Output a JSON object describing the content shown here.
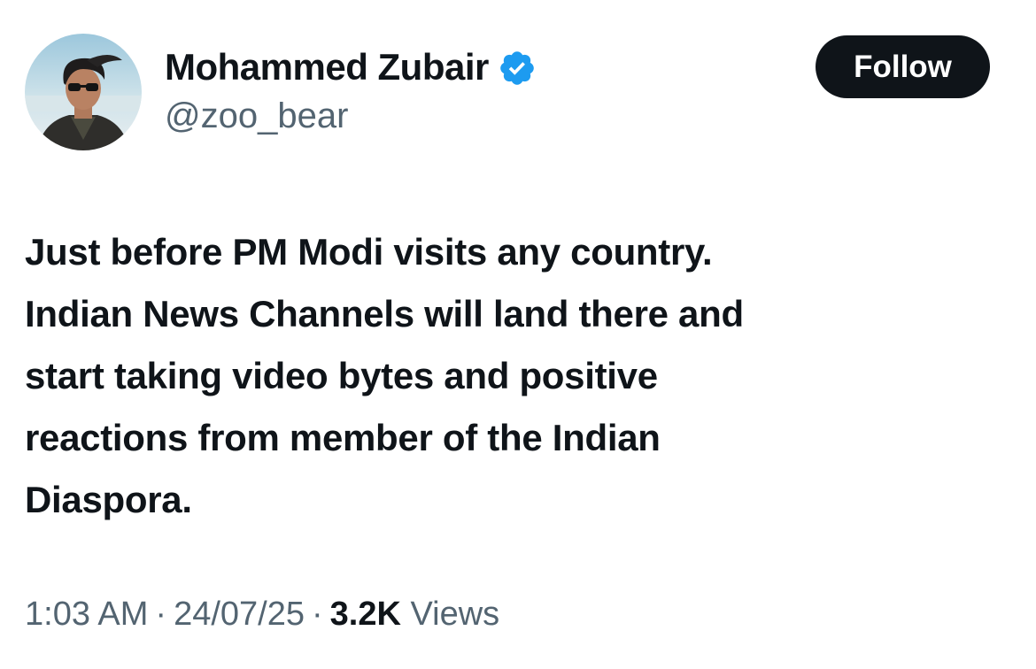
{
  "author": {
    "display_name": "Mohammed Zubair",
    "handle": "@zoo_bear",
    "verified": true,
    "avatar_icon": "profile-photo",
    "verified_icon": "verified-badge-icon",
    "verified_color": "#1d9bf0"
  },
  "follow_button": {
    "label": "Follow",
    "background": "#0f1419",
    "text_color": "#ffffff"
  },
  "tweet": {
    "lines": [
      "Just before PM Modi visits any country.",
      "Indian News Channels will land there and",
      "start taking video bytes and positive",
      "reactions from member of the Indian",
      "Diaspora."
    ]
  },
  "meta": {
    "time": "1:03 AM",
    "separator": "·",
    "date": "24/07/25",
    "views_count": "3.2K",
    "views_label": "Views"
  }
}
